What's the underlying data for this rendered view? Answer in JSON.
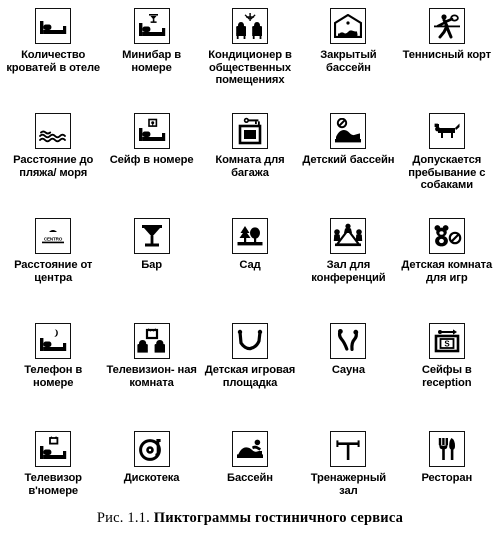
{
  "figure": {
    "caption_number": "Рис. 1.1.",
    "caption_title": "Пиктограммы гостиничного сервиса",
    "columns": 5,
    "rows": 5,
    "ink_color": "#000000",
    "background_color": "#ffffff"
  },
  "pictograms": [
    {
      "id": "beds-count",
      "icon": "bed-icon",
      "label": "Количество кроватей в отеле"
    },
    {
      "id": "minibar",
      "icon": "bed-with-glass-icon",
      "label": "Минибар в номере"
    },
    {
      "id": "air-conditioning",
      "icon": "armchairs-snowflake-icon",
      "label": "Кондиционер в общественных помещениях"
    },
    {
      "id": "indoor-pool",
      "icon": "house-pool-icon",
      "label": "Закрытый бассейн"
    },
    {
      "id": "tennis-court",
      "icon": "tennis-player-icon",
      "label": "Теннисный корт"
    },
    {
      "id": "distance-to-beach",
      "icon": "waves-icon",
      "label": "Расстояние до пляжа/ моря"
    },
    {
      "id": "room-safe",
      "icon": "bed-with-safe-icon",
      "label": "Сейф в номере"
    },
    {
      "id": "luggage-room",
      "icon": "luggage-key-icon",
      "label": "Комната для багажа"
    },
    {
      "id": "kids-pool",
      "icon": "pool-no-entry-icon",
      "label": "Детский бассейн"
    },
    {
      "id": "pets-allowed",
      "icon": "dog-icon",
      "label": "Допускается пребывание с собаками"
    },
    {
      "id": "distance-to-center",
      "icon": "centro-sign-icon",
      "label": "Расстояние от центра",
      "icon_text": "CENTRO"
    },
    {
      "id": "bar",
      "icon": "cocktail-glass-icon",
      "label": "Бар"
    },
    {
      "id": "garden",
      "icon": "trees-icon",
      "label": "Сад"
    },
    {
      "id": "conference-hall",
      "icon": "conference-table-icon",
      "label": "Зал для конференций"
    },
    {
      "id": "kids-playroom",
      "icon": "teddy-bear-icon",
      "label": "Детская комната для игр"
    },
    {
      "id": "room-phone",
      "icon": "bed-with-phone-icon",
      "label": "Телефон в номере"
    },
    {
      "id": "tv-room",
      "icon": "tv-armchairs-icon",
      "label": "Телевизион- ная комната"
    },
    {
      "id": "playground",
      "icon": "swing-icon",
      "label": "Детская игровая площадка"
    },
    {
      "id": "sauna",
      "icon": "sauna-icon",
      "label": "Сауна"
    },
    {
      "id": "reception-safes",
      "icon": "safe-box-icon",
      "label": "Сейфы в reception"
    },
    {
      "id": "room-tv",
      "icon": "bed-with-tv-icon",
      "label": "Телевизор в'номере"
    },
    {
      "id": "disco",
      "icon": "record-player-icon",
      "label": "Дискотека"
    },
    {
      "id": "pool",
      "icon": "swimmer-icon",
      "label": "Бассейн"
    },
    {
      "id": "gym",
      "icon": "barbell-icon",
      "label": "Тренажерный зал"
    },
    {
      "id": "restaurant",
      "icon": "fork-knife-icon",
      "label": "Ресторан"
    }
  ]
}
